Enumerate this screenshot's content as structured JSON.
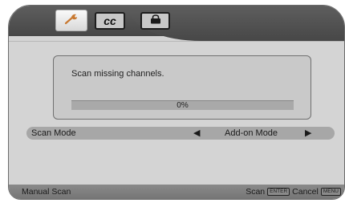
{
  "tabs": [
    {
      "name": "setup",
      "icon": "wrench-icon",
      "active": true
    },
    {
      "name": "closed-caption",
      "label": "cc",
      "active": false
    },
    {
      "name": "lock",
      "icon": "lock-icon",
      "active": false
    }
  ],
  "dialog": {
    "message": "Scan missing channels.",
    "progress_label": "0%",
    "progress_value": 0
  },
  "scan_mode": {
    "label": "Scan Mode",
    "value": "Add-on Mode"
  },
  "footer": {
    "title": "Manual Scan",
    "scan_label": "Scan",
    "enter_key": "ENTER",
    "cancel_label": "Cancel",
    "menu_key": "MENU"
  },
  "colors": {
    "panel": "#d4d4d4",
    "header": "#525252",
    "row_highlight": "#a7a7a7",
    "footer": "#808080"
  }
}
